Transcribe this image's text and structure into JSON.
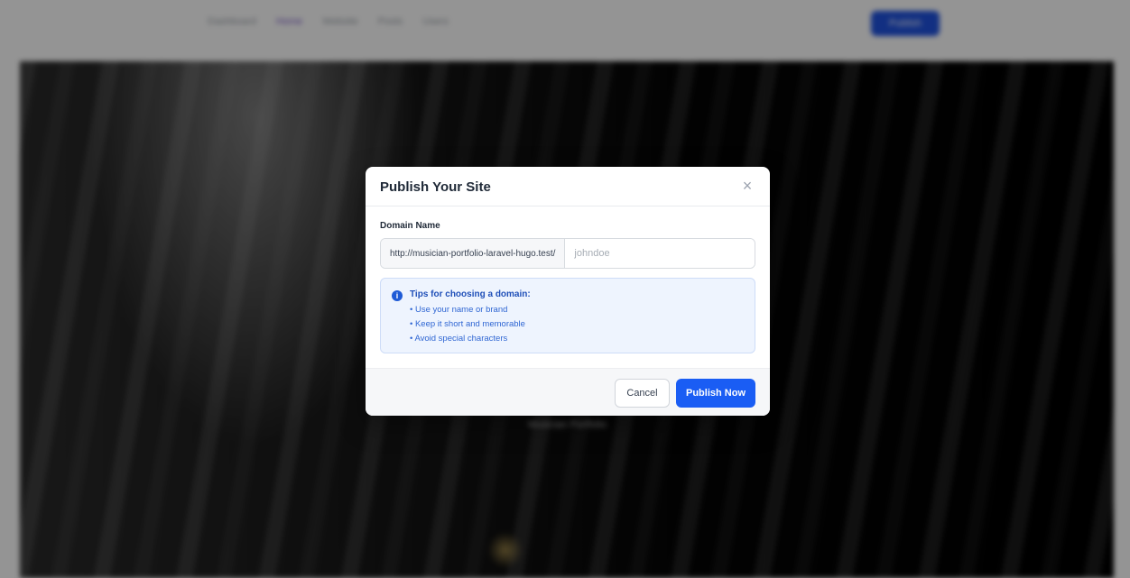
{
  "background": {
    "nav_links": [
      "Dashboard",
      "Home",
      "Website",
      "Posts",
      "Users"
    ],
    "nav_button": "Publish",
    "hero_text": "Musician Portfolio"
  },
  "modal": {
    "title": "Publish Your Site",
    "close_icon": "close-icon",
    "domain_label": "Domain Name",
    "domain_prefix": "http://musician-portfolio-laravel-hugo.test/",
    "domain_value": "",
    "domain_placeholder": "johndoe",
    "tips": {
      "icon": "info-icon",
      "title": "Tips for choosing a domain:",
      "items": [
        "• Use your name or brand",
        "• Keep it short and memorable",
        "• Avoid special characters"
      ]
    },
    "cancel_label": "Cancel",
    "publish_label": "Publish Now"
  },
  "colors": {
    "primary": "#1a5df4",
    "tips_bg": "#eef4fe",
    "tips_text": "#2f66d3",
    "overlay": "rgba(0,0,0,0.42)"
  }
}
